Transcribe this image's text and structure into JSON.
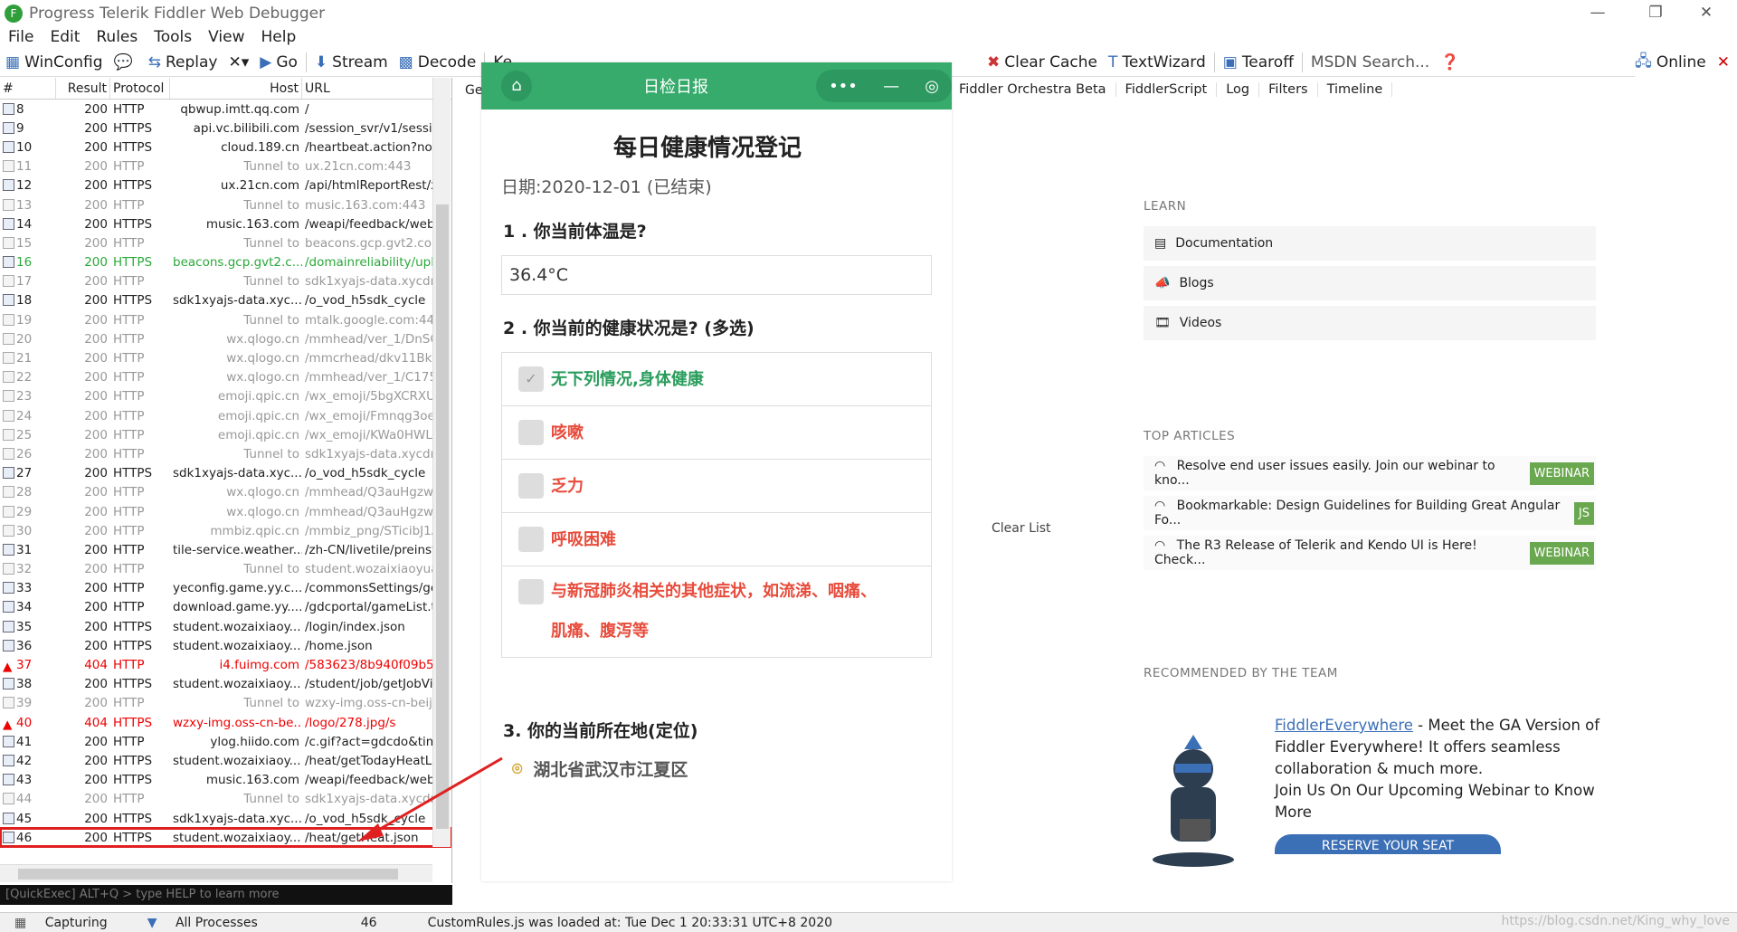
{
  "window": {
    "title": "Progress Telerik Fiddler Web Debugger",
    "app_icon": "F"
  },
  "menu": [
    "File",
    "Edit",
    "Rules",
    "Tools",
    "View",
    "Help"
  ],
  "toolbar": {
    "winconfig": "WinConfig",
    "replay": "Replay",
    "go": "Go",
    "stream": "Stream",
    "decode": "Decode",
    "keep": "Ke",
    "all": "All",
    "clear_cache": "Clear Cache",
    "textwizard": "TextWizard",
    "tearoff": "Tearoff",
    "msdn": "MSDN Search...",
    "online": "Online"
  },
  "columns": [
    "#",
    "Result",
    "Protocol",
    "Host",
    "URL"
  ],
  "rows": [
    {
      "id": "8",
      "res": "200",
      "proto": "HTTP",
      "host": "qbwup.imtt.qq.com",
      "url": "/",
      "t": "n"
    },
    {
      "id": "9",
      "res": "200",
      "proto": "HTTPS",
      "host": "api.vc.bilibili.com",
      "url": "/session_svr/v1/sessic",
      "t": "n"
    },
    {
      "id": "10",
      "res": "200",
      "proto": "HTTPS",
      "host": "cloud.189.cn",
      "url": "/heartbeat.action?noC",
      "t": "n"
    },
    {
      "id": "11",
      "res": "200",
      "proto": "HTTP",
      "host": "Tunnel to",
      "url": "ux.21cn.com:443",
      "t": "tunnel"
    },
    {
      "id": "12",
      "res": "200",
      "proto": "HTTPS",
      "host": "ux.21cn.com",
      "url": "/api/htmlReportRest/x",
      "t": "n"
    },
    {
      "id": "13",
      "res": "200",
      "proto": "HTTP",
      "host": "Tunnel to",
      "url": "music.163.com:443",
      "t": "tunnel"
    },
    {
      "id": "14",
      "res": "200",
      "proto": "HTTPS",
      "host": "music.163.com",
      "url": "/weapi/feedback/webl",
      "t": "n"
    },
    {
      "id": "15",
      "res": "200",
      "proto": "HTTP",
      "host": "Tunnel to",
      "url": "beacons.gcp.gvt2.cor",
      "t": "tunnel"
    },
    {
      "id": "16",
      "res": "200",
      "proto": "HTTPS",
      "host": "beacons.gcp.gvt2.c...",
      "url": "/domainreliability/uplo",
      "t": "green"
    },
    {
      "id": "17",
      "res": "200",
      "proto": "HTTP",
      "host": "Tunnel to",
      "url": "sdk1xyajs-data.xycdr",
      "t": "tunnel"
    },
    {
      "id": "18",
      "res": "200",
      "proto": "HTTPS",
      "host": "sdk1xyajs-data.xyc...",
      "url": "/o_vod_h5sdk_cycle",
      "t": "n"
    },
    {
      "id": "19",
      "res": "200",
      "proto": "HTTP",
      "host": "Tunnel to",
      "url": "mtalk.google.com:443",
      "t": "tunnel"
    },
    {
      "id": "20",
      "res": "200",
      "proto": "HTTP",
      "host": "wx.qlogo.cn",
      "url": "/mmhead/ver_1/DnSC",
      "t": "tunnel"
    },
    {
      "id": "21",
      "res": "200",
      "proto": "HTTP",
      "host": "wx.qlogo.cn",
      "url": "/mmcrhead/dkv11BktE",
      "t": "tunnel"
    },
    {
      "id": "22",
      "res": "200",
      "proto": "HTTP",
      "host": "wx.qlogo.cn",
      "url": "/mmhead/ver_1/C175",
      "t": "tunnel"
    },
    {
      "id": "23",
      "res": "200",
      "proto": "HTTP",
      "host": "emoji.qpic.cn",
      "url": "/wx_emoji/5bgXCRXU",
      "t": "tunnel"
    },
    {
      "id": "24",
      "res": "200",
      "proto": "HTTP",
      "host": "emoji.qpic.cn",
      "url": "/wx_emoji/Fmnqg3oe",
      "t": "tunnel"
    },
    {
      "id": "25",
      "res": "200",
      "proto": "HTTP",
      "host": "emoji.qpic.cn",
      "url": "/wx_emoji/KWa0HWL:",
      "t": "tunnel"
    },
    {
      "id": "26",
      "res": "200",
      "proto": "HTTP",
      "host": "Tunnel to",
      "url": "sdk1xyajs-data.xycdr",
      "t": "tunnel"
    },
    {
      "id": "27",
      "res": "200",
      "proto": "HTTPS",
      "host": "sdk1xyajs-data.xyc...",
      "url": "/o_vod_h5sdk_cycle",
      "t": "n"
    },
    {
      "id": "28",
      "res": "200",
      "proto": "HTTP",
      "host": "wx.qlogo.cn",
      "url": "/mmhead/Q3auHgzwz",
      "t": "tunnel"
    },
    {
      "id": "29",
      "res": "200",
      "proto": "HTTP",
      "host": "wx.qlogo.cn",
      "url": "/mmhead/Q3auHgzwz",
      "t": "tunnel"
    },
    {
      "id": "30",
      "res": "200",
      "proto": "HTTP",
      "host": "mmbiz.qpic.cn",
      "url": "/mmbiz_png/STicibJ1A",
      "t": "tunnel"
    },
    {
      "id": "31",
      "res": "200",
      "proto": "HTTP",
      "host": "tile-service.weather....",
      "url": "/zh-CN/livetile/preinst",
      "t": "n"
    },
    {
      "id": "32",
      "res": "200",
      "proto": "HTTP",
      "host": "Tunnel to",
      "url": "student.wozaixiaoyua",
      "t": "tunnel"
    },
    {
      "id": "33",
      "res": "200",
      "proto": "HTTP",
      "host": "yeconfig.game.yy.c...",
      "url": "/commonsSettings/get",
      "t": "n"
    },
    {
      "id": "34",
      "res": "200",
      "proto": "HTTP",
      "host": "download.game.yy....",
      "url": "/gdcportal/gameList.t",
      "t": "n"
    },
    {
      "id": "35",
      "res": "200",
      "proto": "HTTPS",
      "host": "student.wozaixiaoy...",
      "url": "/login/index.json",
      "t": "n"
    },
    {
      "id": "36",
      "res": "200",
      "proto": "HTTPS",
      "host": "student.wozaixiaoy...",
      "url": "/home.json",
      "t": "n"
    },
    {
      "id": "37",
      "res": "404",
      "proto": "HTTP",
      "host": "i4.fuimg.com",
      "url": "/583623/8b940f09b5c",
      "t": "red"
    },
    {
      "id": "38",
      "res": "200",
      "proto": "HTTPS",
      "host": "student.wozaixiaoy...",
      "url": "/student/job/getJobVi",
      "t": "n"
    },
    {
      "id": "39",
      "res": "200",
      "proto": "HTTP",
      "host": "Tunnel to",
      "url": "wzxy-img.oss-cn-beiji",
      "t": "tunnel"
    },
    {
      "id": "40",
      "res": "404",
      "proto": "HTTPS",
      "host": "wzxy-img.oss-cn-be...",
      "url": "/logo/278.jpg/s",
      "t": "red"
    },
    {
      "id": "41",
      "res": "200",
      "proto": "HTTP",
      "host": "ylog.hiido.com",
      "url": "/c.gif?act=gdcdo&tim",
      "t": "n"
    },
    {
      "id": "42",
      "res": "200",
      "proto": "HTTPS",
      "host": "student.wozaixiaoy...",
      "url": "/heat/getTodayHeatLi",
      "t": "n"
    },
    {
      "id": "43",
      "res": "200",
      "proto": "HTTPS",
      "host": "music.163.com",
      "url": "/weapi/feedback/webl",
      "t": "n"
    },
    {
      "id": "44",
      "res": "200",
      "proto": "HTTP",
      "host": "Tunnel to",
      "url": "sdk1xyajs-data.xycdr",
      "t": "tunnel"
    },
    {
      "id": "45",
      "res": "200",
      "proto": "HTTPS",
      "host": "sdk1xyajs-data.xyc...",
      "url": "/o_vod_h5sdk_cycle",
      "t": "n"
    },
    {
      "id": "46",
      "res": "200",
      "proto": "HTTPS",
      "host": "student.wozaixiaoy...",
      "url": "/heat/getHeat.json",
      "t": "sel"
    }
  ],
  "quickexec": "[QuickExec] ALT+Q > type HELP to learn more",
  "status": {
    "capturing": "Capturing",
    "processes": "All Processes",
    "count": "46",
    "msg": "CustomRules.js was loaded at: Tue Dec 1 20:33:31 UTC+8 2020"
  },
  "right_tabs": [
    "Fiddler Orchestra Beta",
    "FiddlerScript",
    "Log",
    "Filters",
    "Timeline"
  ],
  "get_label": "Get",
  "clear_list": "Clear List",
  "learn": {
    "heading": "LEARN",
    "items": [
      "Documentation",
      "Blogs",
      "Videos"
    ]
  },
  "top": {
    "heading": "TOP ARTICLES",
    "items": [
      {
        "text": "Resolve end user issues easily. Join our webinar to kno...",
        "badge": "WEBINAR"
      },
      {
        "text": "Bookmarkable: Design Guidelines for Building Great Angular Fo...",
        "badge": "JS"
      },
      {
        "text": "The R3 Release of Telerik and Kendo UI is Here! Check...",
        "badge": "WEBINAR"
      }
    ]
  },
  "recommended": {
    "heading": "RECOMMENDED BY THE TEAM",
    "link": "FiddlerEverywhere",
    "text": " - Meet the GA Version of Fiddler Everywhere! It offers seamless collaboration & much more.",
    "text2": "Join Us On Our Upcoming Webinar to Know More",
    "button": "RESERVE YOUR SEAT"
  },
  "phone": {
    "title": "日检日报",
    "page_title": "每日健康情况登记",
    "date": "日期:2020-12-01 (已结束)",
    "q1": "1 . 你当前体温是?",
    "a1": "36.4°C",
    "q2": "2 . 你当前的健康状况是? (多选)",
    "opts": [
      "无下列情况,身体健康",
      "咳嗽",
      "乏力",
      "呼吸困难",
      "与新冠肺炎相关的其他症状，如流涕、咽痛、肌痛、腹泻等"
    ],
    "q3": "3. 你的当前所在地(定位)",
    "loc": "湖北省武汉市江夏区"
  },
  "watermark": "https://blog.csdn.net/King_why_love"
}
